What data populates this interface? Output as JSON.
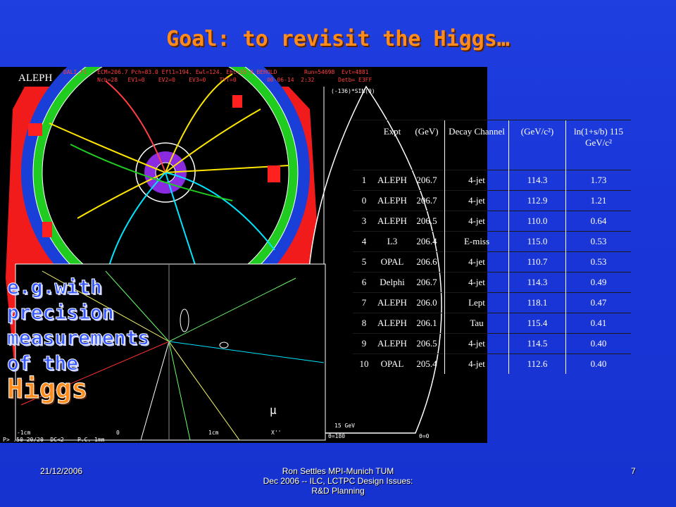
{
  "title": "Goal: to revisit the Higgs…",
  "event_display": {
    "logo": "ALEPH",
    "header_line1": "DALI_F1   ECM=206.7 Pch=83.0 Efl1=194. Ewl=124. Ehc=35.9 BEHOLD        Run=54698  Evt=4881",
    "header_line2": "          Nch=28   EV1=0    EV2=0    EV3=0    TYT=0         00-06-14  2:32       Detb= E3FF",
    "rz_label": "(-136)*SIN(θ)",
    "scale_label": "15 GeV",
    "theta1": "θ=180",
    "theta2": "θ=0",
    "axis_label1": "1cm",
    "axis_label2": "X''",
    "axis_label3": "-1cm",
    "axis_0": "0",
    "bottom_info": "P> .50 20/20  DC<2    P.C. 1mm",
    "mu": "μ"
  },
  "table": {
    "headers": [
      "",
      "Expt",
      "(GeV)",
      "",
      "Decay Channel",
      "(GeV/c²)",
      "ln(1+s/b) 115 GeV/c²"
    ],
    "rows": [
      [
        "1",
        "ALEPH",
        "206.7",
        "",
        "4-jet",
        "114.3",
        "1.73"
      ],
      [
        "0",
        "ALEPH",
        "206.7",
        "",
        "4-jet",
        "112.9",
        "1.21"
      ],
      [
        "3",
        "ALEPH",
        "206.5",
        "",
        "4-jet",
        "110.0",
        "0.64"
      ],
      [
        "4",
        "L3",
        "206.4",
        "",
        "E-miss",
        "115.0",
        "0.53"
      ],
      [
        "5",
        "OPAL",
        "206.6",
        "",
        "4-jet",
        "110.7",
        "0.53"
      ],
      [
        "6",
        "Delphi",
        "206.7",
        "",
        "4-jet",
        "114.3",
        "0.49"
      ],
      [
        "7",
        "ALEPH",
        "206.0",
        "",
        "Lept",
        "118.1",
        "0.47"
      ],
      [
        "8",
        "ALEPH",
        "206.1",
        "",
        "Tau",
        "115.4",
        "0.41"
      ],
      [
        "9",
        "ALEPH",
        "206.5",
        "",
        "4-jet",
        "114.5",
        "0.40"
      ],
      [
        "10",
        "OPAL",
        "205.4",
        "",
        "4-jet",
        "112.6",
        "0.40"
      ]
    ]
  },
  "overlay": {
    "line1": "e.g.with",
    "line2": "precision",
    "line3": "measurements",
    "line4": "of the",
    "line5": "Higgs"
  },
  "footer": {
    "date": "21/12/2006",
    "center_line1": "Ron Settles  MPI-Munich              TUM",
    "center_line2": "Dec 2006 -- ILC, LCTPC Design Issues:",
    "center_line3": "R&D Planning",
    "page": "7"
  }
}
